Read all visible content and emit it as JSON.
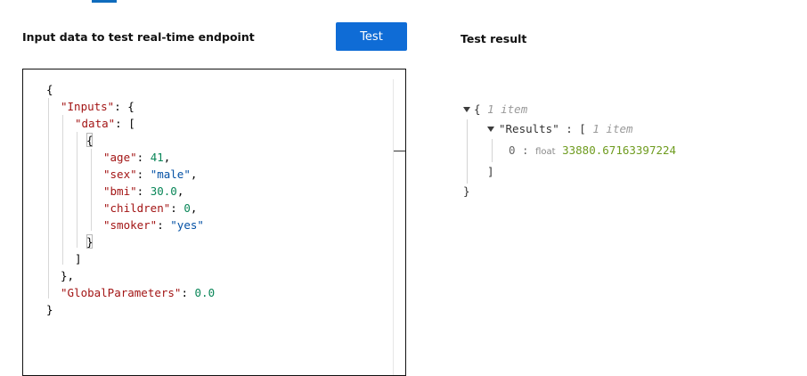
{
  "input_panel": {
    "title": "Input data to test real-time endpoint",
    "test_button_label": "Test",
    "code_lines": [
      {
        "tokens": [
          {
            "t": "{",
            "c": "tk-punct"
          }
        ]
      },
      {
        "tokens": [
          {
            "t": "\"Inputs\"",
            "c": "tk-key"
          },
          {
            "t": ": {",
            "c": "tk-punct"
          }
        ]
      },
      {
        "tokens": [
          {
            "t": "\"data\"",
            "c": "tk-key"
          },
          {
            "t": ": [",
            "c": "tk-punct"
          }
        ]
      },
      {
        "tokens": [
          {
            "t": "{",
            "c": "tk-punct"
          }
        ]
      },
      {
        "tokens": [
          {
            "t": "\"age\"",
            "c": "tk-key"
          },
          {
            "t": ": ",
            "c": "tk-punct"
          },
          {
            "t": "41",
            "c": "tk-num"
          },
          {
            "t": ",",
            "c": "tk-punct"
          }
        ]
      },
      {
        "tokens": [
          {
            "t": "\"sex\"",
            "c": "tk-key"
          },
          {
            "t": ": ",
            "c": "tk-punct"
          },
          {
            "t": "\"male\"",
            "c": "tk-str"
          },
          {
            "t": ",",
            "c": "tk-punct"
          }
        ]
      },
      {
        "tokens": [
          {
            "t": "\"bmi\"",
            "c": "tk-key"
          },
          {
            "t": ": ",
            "c": "tk-punct"
          },
          {
            "t": "30.0",
            "c": "tk-num"
          },
          {
            "t": ",",
            "c": "tk-punct"
          }
        ]
      },
      {
        "tokens": [
          {
            "t": "\"children\"",
            "c": "tk-key"
          },
          {
            "t": ": ",
            "c": "tk-punct"
          },
          {
            "t": "0",
            "c": "tk-num"
          },
          {
            "t": ",",
            "c": "tk-punct"
          }
        ]
      },
      {
        "tokens": [
          {
            "t": "\"smoker\"",
            "c": "tk-key"
          },
          {
            "t": ": ",
            "c": "tk-punct"
          },
          {
            "t": "\"yes\"",
            "c": "tk-str"
          }
        ]
      },
      {
        "tokens": [
          {
            "t": "}",
            "c": "tk-punct"
          }
        ]
      },
      {
        "tokens": [
          {
            "t": "]",
            "c": "tk-punct"
          }
        ]
      },
      {
        "tokens": [
          {
            "t": "},",
            "c": "tk-punct"
          }
        ]
      },
      {
        "tokens": [
          {
            "t": "\"GlobalParameters\"",
            "c": "tk-key"
          },
          {
            "t": ": ",
            "c": "tk-punct"
          },
          {
            "t": "0.0",
            "c": "tk-num"
          }
        ]
      },
      {
        "tokens": [
          {
            "t": "}",
            "c": "tk-punct"
          }
        ]
      }
    ]
  },
  "result_panel": {
    "title": "Test result",
    "root_open": "{",
    "root_meta": "1 item",
    "results_key": "\"Results\"",
    "results_sep": " : [",
    "results_meta": "1 item",
    "item_index": "0 :",
    "item_type": "float",
    "item_value": "33880.67163397224",
    "results_close": "]",
    "root_close": "}"
  },
  "colors": {
    "accent": "#0f6cd6",
    "json_key": "#a31515",
    "json_number": "#098658",
    "json_string": "#0451a5",
    "result_value": "#6f9c20"
  }
}
